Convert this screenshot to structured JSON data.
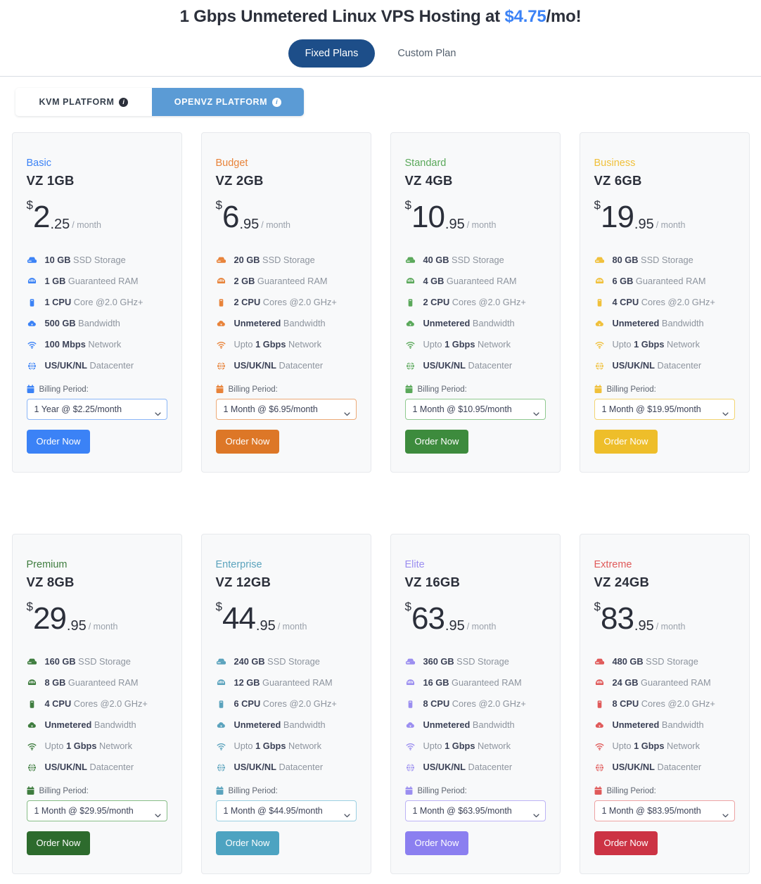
{
  "header": {
    "title_prefix": "1 Gbps Unmetered Linux VPS Hosting at ",
    "title_price": "$4.75",
    "title_suffix": "/mo!",
    "plan_tabs": [
      {
        "label": "Fixed Plans",
        "active": true
      },
      {
        "label": "Custom Plan",
        "active": false
      }
    ],
    "platform_tabs": [
      {
        "label": "KVM PLATFORM",
        "info": "i",
        "active": false
      },
      {
        "label": "OPENVZ PLATFORM",
        "info": "i",
        "active": true
      }
    ]
  },
  "labels": {
    "billing_period": "Billing Period:",
    "order_now": "Order Now",
    "per_month": "/ month",
    "currency": "$"
  },
  "plans": [
    {
      "label": "Basic",
      "name": "VZ 1GB",
      "price_whole": "2",
      "price_cents": ".25",
      "color": "#3b82f6",
      "btn_bg": "#3b82f6",
      "btn_fg": "#ffffff",
      "select_border": "#8bb6f7",
      "features": [
        {
          "icon": "hdd-icon",
          "pre": "",
          "value": "10 GB",
          "suffix": " SSD Storage"
        },
        {
          "icon": "ram-icon",
          "pre": "",
          "value": "1 GB",
          "suffix": " Guaranteed RAM"
        },
        {
          "icon": "cpu-icon",
          "pre": "",
          "value": "1 CPU",
          "suffix": " Core @2.0 GHz+"
        },
        {
          "icon": "cloud-icon",
          "pre": "",
          "value": "500 GB",
          "suffix": " Bandwidth"
        },
        {
          "icon": "wifi-icon",
          "pre": "",
          "value": "100 Mbps",
          "suffix": " Network"
        },
        {
          "icon": "globe-icon",
          "pre": "",
          "value": "US/UK/NL",
          "suffix": " Datacenter"
        }
      ],
      "billing_option": "1 Year @ $2.25/month"
    },
    {
      "label": "Budget",
      "name": "VZ 2GB",
      "price_whole": "6",
      "price_cents": ".95",
      "color": "#e8833a",
      "btn_bg": "#dd7727",
      "btn_fg": "#ffffff",
      "select_border": "#edaa78",
      "features": [
        {
          "icon": "hdd-icon",
          "pre": "",
          "value": "20 GB",
          "suffix": " SSD Storage"
        },
        {
          "icon": "ram-icon",
          "pre": "",
          "value": "2 GB",
          "suffix": " Guaranteed RAM"
        },
        {
          "icon": "cpu-icon",
          "pre": "",
          "value": "2 CPU",
          "suffix": " Cores @2.0 GHz+"
        },
        {
          "icon": "cloud-icon",
          "pre": "",
          "value": "Unmetered",
          "suffix": " Bandwidth"
        },
        {
          "icon": "wifi-icon",
          "pre": "Upto ",
          "value": "1 Gbps",
          "suffix": " Network"
        },
        {
          "icon": "globe-icon",
          "pre": "",
          "value": "US/UK/NL",
          "suffix": " Datacenter"
        }
      ],
      "billing_option": "1 Month @ $6.95/month"
    },
    {
      "label": "Standard",
      "name": "VZ 4GB",
      "price_whole": "10",
      "price_cents": ".95",
      "color": "#5aa85a",
      "btn_bg": "#3d8b3d",
      "btn_fg": "#ffffff",
      "select_border": "#8fc98f",
      "features": [
        {
          "icon": "hdd-icon",
          "pre": "",
          "value": "40 GB",
          "suffix": " SSD Storage"
        },
        {
          "icon": "ram-icon",
          "pre": "",
          "value": "4 GB",
          "suffix": " Guaranteed RAM"
        },
        {
          "icon": "cpu-icon",
          "pre": "",
          "value": "2 CPU",
          "suffix": " Cores @2.0 GHz+"
        },
        {
          "icon": "cloud-icon",
          "pre": "",
          "value": "Unmetered",
          "suffix": " Bandwidth"
        },
        {
          "icon": "wifi-icon",
          "pre": "Upto ",
          "value": "1 Gbps",
          "suffix": " Network"
        },
        {
          "icon": "globe-icon",
          "pre": "",
          "value": "US/UK/NL",
          "suffix": " Datacenter"
        }
      ],
      "billing_option": "1 Month @ $10.95/month"
    },
    {
      "label": "Business",
      "name": "VZ 6GB",
      "price_whole": "19",
      "price_cents": ".95",
      "color": "#f0c03a",
      "btn_bg": "#eebe2a",
      "btn_fg": "#ffffff",
      "select_border": "#f2d472",
      "features": [
        {
          "icon": "hdd-icon",
          "pre": "",
          "value": "80 GB",
          "suffix": " SSD Storage"
        },
        {
          "icon": "ram-icon",
          "pre": "",
          "value": "6 GB",
          "suffix": " Guaranteed RAM"
        },
        {
          "icon": "cpu-icon",
          "pre": "",
          "value": "4 CPU",
          "suffix": " Cores @2.0 GHz+"
        },
        {
          "icon": "cloud-icon",
          "pre": "",
          "value": "Unmetered",
          "suffix": " Bandwidth"
        },
        {
          "icon": "wifi-icon",
          "pre": "Upto ",
          "value": "1 Gbps",
          "suffix": " Network"
        },
        {
          "icon": "globe-icon",
          "pre": "",
          "value": "US/UK/NL",
          "suffix": " Datacenter"
        }
      ],
      "billing_option": "1 Month @ $19.95/month"
    },
    {
      "label": "Premium",
      "name": "VZ 8GB",
      "price_whole": "29",
      "price_cents": ".95",
      "color": "#3f7d3f",
      "btn_bg": "#2d6b2d",
      "btn_fg": "#ffffff",
      "select_border": "#87bd87",
      "features": [
        {
          "icon": "hdd-icon",
          "pre": "",
          "value": "160 GB",
          "suffix": " SSD Storage"
        },
        {
          "icon": "ram-icon",
          "pre": "",
          "value": "8 GB",
          "suffix": " Guaranteed RAM"
        },
        {
          "icon": "cpu-icon",
          "pre": "",
          "value": "4 CPU",
          "suffix": " Cores @2.0 GHz+"
        },
        {
          "icon": "cloud-icon",
          "pre": "",
          "value": "Unmetered",
          "suffix": " Bandwidth"
        },
        {
          "icon": "wifi-icon",
          "pre": "Upto ",
          "value": "1 Gbps",
          "suffix": " Network"
        },
        {
          "icon": "globe-icon",
          "pre": "",
          "value": "US/UK/NL",
          "suffix": " Datacenter"
        }
      ],
      "billing_option": "1 Month @ $29.95/month"
    },
    {
      "label": "Enterprise",
      "name": "VZ 12GB",
      "price_whole": "44",
      "price_cents": ".95",
      "color": "#5ba3bd",
      "btn_bg": "#4da3c1",
      "btn_fg": "#ffffff",
      "select_border": "#9bd0e2",
      "features": [
        {
          "icon": "hdd-icon",
          "pre": "",
          "value": "240 GB",
          "suffix": " SSD Storage"
        },
        {
          "icon": "ram-icon",
          "pre": "",
          "value": "12 GB",
          "suffix": " Guaranteed RAM"
        },
        {
          "icon": "cpu-icon",
          "pre": "",
          "value": "6 CPU",
          "suffix": " Cores @2.0 GHz+"
        },
        {
          "icon": "cloud-icon",
          "pre": "",
          "value": "Unmetered",
          "suffix": " Bandwidth"
        },
        {
          "icon": "wifi-icon",
          "pre": "Upto ",
          "value": "1 Gbps",
          "suffix": " Network"
        },
        {
          "icon": "globe-icon",
          "pre": "",
          "value": "US/UK/NL",
          "suffix": " Datacenter"
        }
      ],
      "billing_option": "1 Month @ $44.95/month"
    },
    {
      "label": "Elite",
      "name": "VZ 16GB",
      "price_whole": "63",
      "price_cents": ".95",
      "color": "#9b8ef0",
      "btn_bg": "#8b7ff0",
      "btn_fg": "#ffffff",
      "select_border": "#bcb3f5",
      "features": [
        {
          "icon": "hdd-icon",
          "pre": "",
          "value": "360 GB",
          "suffix": " SSD Storage"
        },
        {
          "icon": "ram-icon",
          "pre": "",
          "value": "16 GB",
          "suffix": " Guaranteed RAM"
        },
        {
          "icon": "cpu-icon",
          "pre": "",
          "value": "8 CPU",
          "suffix": " Cores @2.0 GHz+"
        },
        {
          "icon": "cloud-icon",
          "pre": "",
          "value": "Unmetered",
          "suffix": " Bandwidth"
        },
        {
          "icon": "wifi-icon",
          "pre": "Upto ",
          "value": "1 Gbps",
          "suffix": " Network"
        },
        {
          "icon": "globe-icon",
          "pre": "",
          "value": "US/UK/NL",
          "suffix": " Datacenter"
        }
      ],
      "billing_option": "1 Month @ $63.95/month"
    },
    {
      "label": "Extreme",
      "name": "VZ 24GB",
      "price_whole": "83",
      "price_cents": ".95",
      "color": "#e05a5a",
      "btn_bg": "#cc3344",
      "btn_fg": "#ffffff",
      "select_border": "#eda3a3",
      "features": [
        {
          "icon": "hdd-icon",
          "pre": "",
          "value": "480 GB",
          "suffix": " SSD Storage"
        },
        {
          "icon": "ram-icon",
          "pre": "",
          "value": "24 GB",
          "suffix": " Guaranteed RAM"
        },
        {
          "icon": "cpu-icon",
          "pre": "",
          "value": "8 CPU",
          "suffix": " Cores @2.0 GHz+"
        },
        {
          "icon": "cloud-icon",
          "pre": "",
          "value": "Unmetered",
          "suffix": " Bandwidth"
        },
        {
          "icon": "wifi-icon",
          "pre": "Upto ",
          "value": "1 Gbps",
          "suffix": " Network"
        },
        {
          "icon": "globe-icon",
          "pre": "",
          "value": "US/UK/NL",
          "suffix": " Datacenter"
        }
      ],
      "billing_option": "1 Month @ $83.95/month"
    }
  ]
}
